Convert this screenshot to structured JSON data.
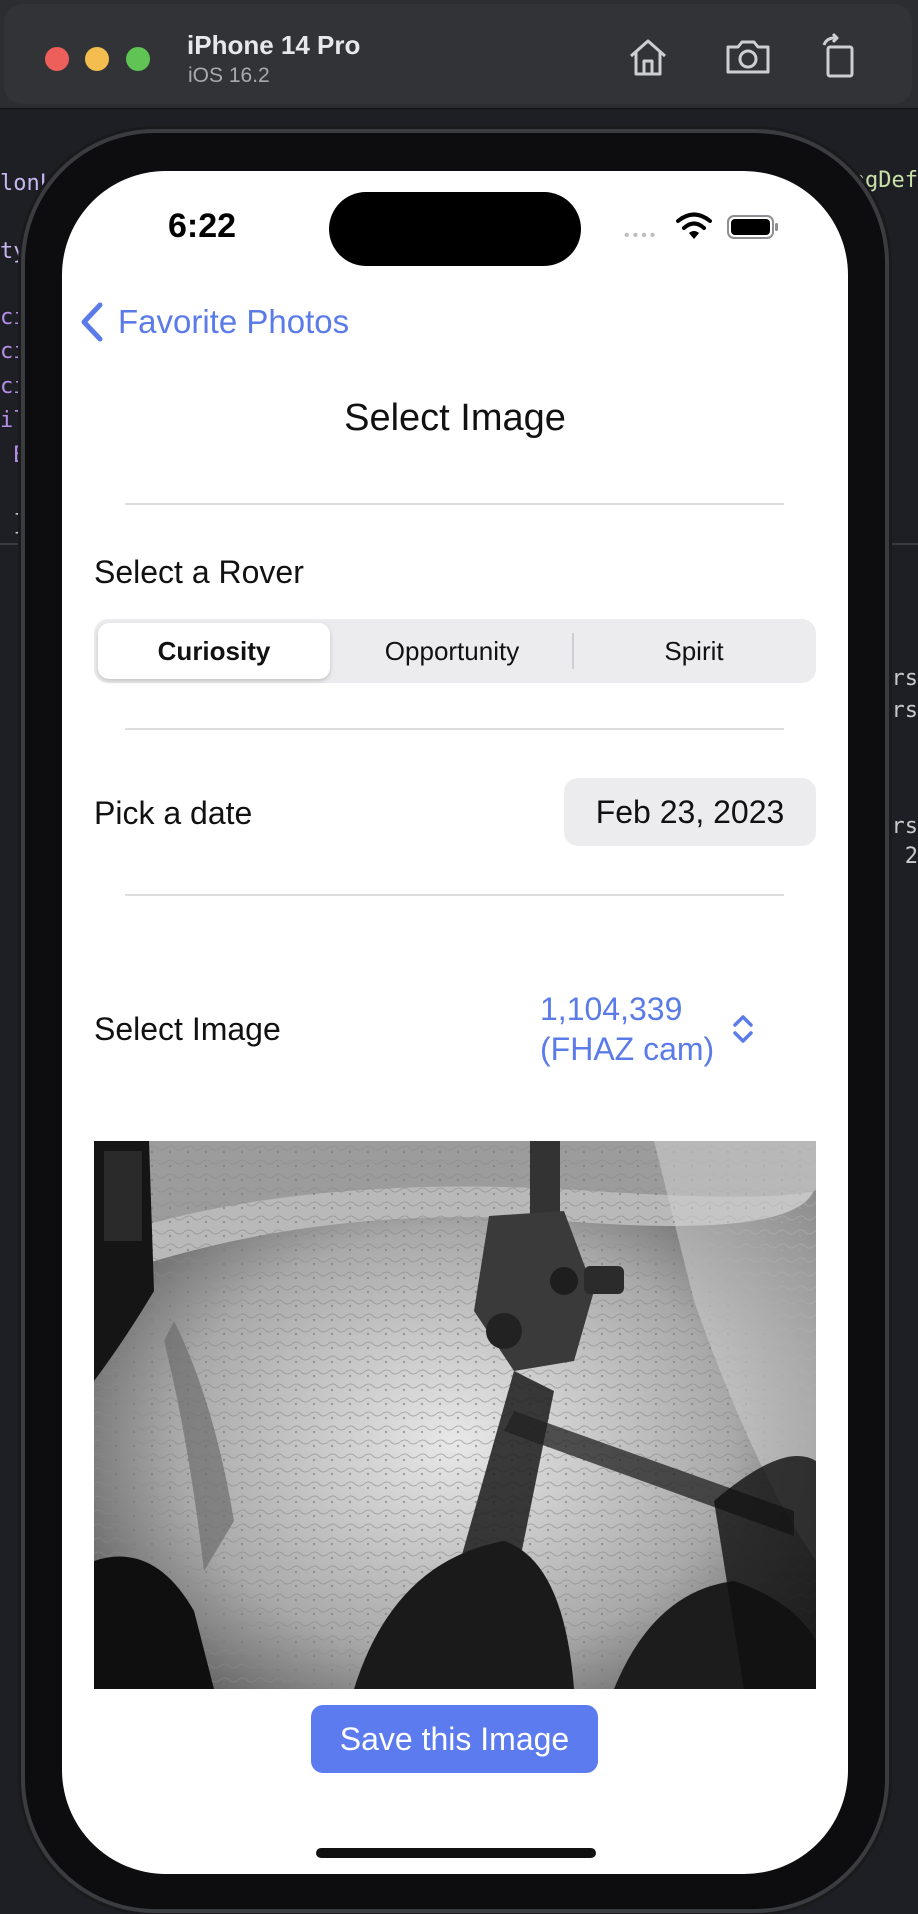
{
  "simulator": {
    "device_name": "iPhone 14 Pro",
    "os_version": "iOS 16.2",
    "icons": [
      "home-icon",
      "screenshot-icon",
      "rotate-icon"
    ]
  },
  "background_code": {
    "left_fragments": [
      "lonLi",
      "tyV",
      "cie",
      "cie",
      "cie",
      "ill",
      " Bo",
      " }"
    ],
    "right_fragments": [
      "ingDef",
      "ars",
      "ars",
      "ars",
      "2"
    ]
  },
  "status_bar": {
    "time": "6:22",
    "signal_dots": "••••"
  },
  "nav": {
    "back_label": "Favorite Photos"
  },
  "page": {
    "title": "Select Image"
  },
  "rover": {
    "label": "Select a Rover",
    "options": [
      "Curiosity",
      "Opportunity",
      "Spirit"
    ],
    "selected": "Curiosity"
  },
  "date": {
    "label": "Pick a date",
    "value": "Feb 23, 2023"
  },
  "image_select": {
    "label": "Select Image",
    "value_line1": "1,104,339",
    "value_line2": "(FHAZ cam)"
  },
  "photo": {
    "description_icon": "mars-rover-photo"
  },
  "actions": {
    "save_label": "Save this Image"
  },
  "colors": {
    "accent": "#5b7be8",
    "save_button": "#5b7bef",
    "segment_bg": "#ececee"
  }
}
